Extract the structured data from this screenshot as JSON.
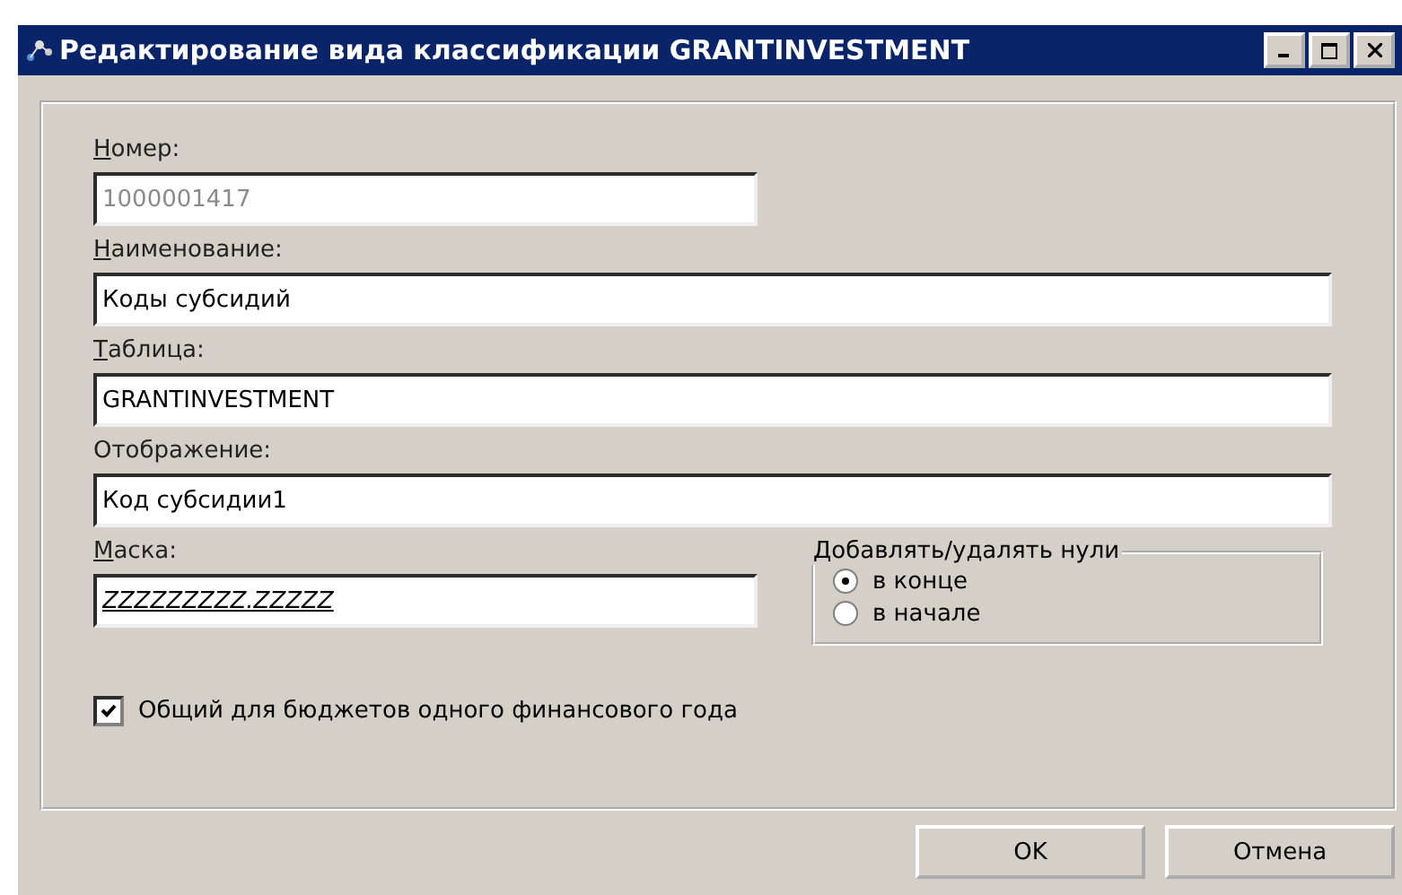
{
  "window": {
    "title": "Редактирование вида классификации GRANTINVESTMENT"
  },
  "fields": [
    {
      "label": "Номер:",
      "underline_first": true,
      "value": "1000001417",
      "disabled": true,
      "kind": "short",
      "mask": false
    },
    {
      "label": "Наименование:",
      "underline_first": true,
      "value": "Коды субсидий",
      "disabled": false,
      "kind": "wide",
      "mask": false
    },
    {
      "label": "Таблица:",
      "underline_first": true,
      "value": "GRANTINVESTMENT",
      "disabled": false,
      "kind": "wide",
      "mask": false
    },
    {
      "label": "Отображение:",
      "underline_first": false,
      "value": "Код субсидии1",
      "disabled": false,
      "kind": "wide",
      "mask": false
    },
    {
      "label": "Маска:",
      "underline_first": true,
      "value": "ZZZZZZZZZ.ZZZZZ",
      "disabled": false,
      "kind": "short",
      "mask": true
    }
  ],
  "zeros_group": {
    "title": "Добавлять/удалять нули",
    "options": [
      {
        "label": "в конце",
        "selected": true
      },
      {
        "label": "в начале",
        "selected": false
      }
    ]
  },
  "shared_checkbox": {
    "label": "Общий для бюджетов одного финансового года",
    "checked": true
  },
  "buttons": [
    "OK",
    "Отмена"
  ]
}
